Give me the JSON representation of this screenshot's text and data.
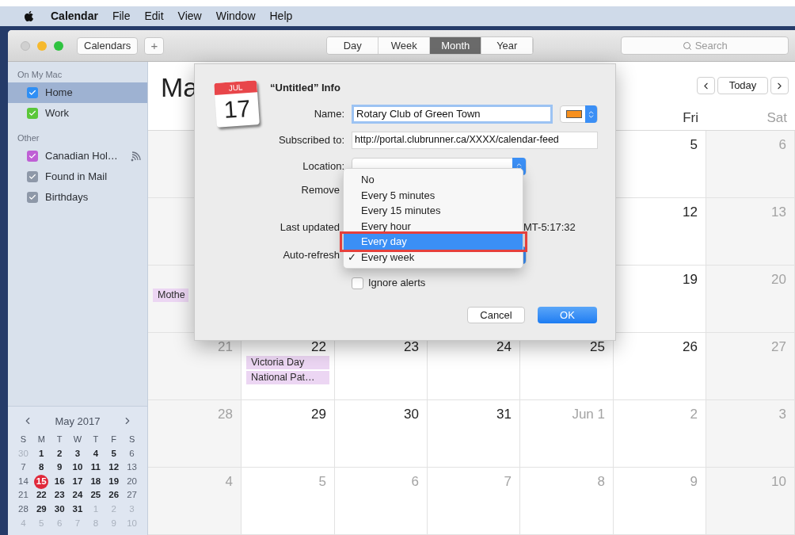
{
  "menubar": {
    "app": "Calendar",
    "items": [
      "File",
      "Edit",
      "View",
      "Window",
      "Help"
    ]
  },
  "toolbar": {
    "calendars_button": "Calendars",
    "add_button": "+",
    "views": [
      {
        "label": "Day",
        "selected": false
      },
      {
        "label": "Week",
        "selected": false
      },
      {
        "label": "Month",
        "selected": true
      },
      {
        "label": "Year",
        "selected": false
      }
    ],
    "search": {
      "placeholder": "Search"
    }
  },
  "sidebar": {
    "groups": [
      {
        "title": "On My Mac",
        "items": [
          {
            "name": "Home",
            "checked": true,
            "selected": true,
            "color": "#2f8ff5",
            "subscribed": false
          },
          {
            "name": "Work",
            "checked": true,
            "selected": false,
            "color": "#5bc73a",
            "subscribed": false
          }
        ]
      },
      {
        "title": "Other",
        "items": [
          {
            "name": "Canadian Hol…",
            "checked": true,
            "selected": false,
            "color": "#bf5fd5",
            "subscribed": true
          },
          {
            "name": "Found in Mail",
            "checked": true,
            "selected": false,
            "color": "#8e98a8",
            "subscribed": false
          },
          {
            "name": "Birthdays",
            "checked": true,
            "selected": false,
            "color": "#8e98a8",
            "subscribed": false
          }
        ]
      }
    ]
  },
  "mini_calendar": {
    "title": "May 2017",
    "weekdays": [
      "S",
      "M",
      "T",
      "W",
      "T",
      "F",
      "S"
    ],
    "weeks": [
      [
        {
          "day": "30",
          "kind": "other",
          "selected": false
        },
        {
          "day": "1",
          "kind": "weekday",
          "selected": false
        },
        {
          "day": "2",
          "kind": "weekday",
          "selected": false
        },
        {
          "day": "3",
          "kind": "weekday",
          "selected": false
        },
        {
          "day": "4",
          "kind": "weekday",
          "selected": false
        },
        {
          "day": "5",
          "kind": "weekday",
          "selected": false
        },
        {
          "day": "6",
          "kind": "weekend",
          "selected": false
        }
      ],
      [
        {
          "day": "7",
          "kind": "weekend",
          "selected": false
        },
        {
          "day": "8",
          "kind": "weekday",
          "selected": false
        },
        {
          "day": "9",
          "kind": "weekday",
          "selected": false
        },
        {
          "day": "10",
          "kind": "weekday",
          "selected": false
        },
        {
          "day": "11",
          "kind": "weekday",
          "selected": false
        },
        {
          "day": "12",
          "kind": "weekday",
          "selected": false
        },
        {
          "day": "13",
          "kind": "weekend",
          "selected": false
        }
      ],
      [
        {
          "day": "14",
          "kind": "weekend",
          "selected": false
        },
        {
          "day": "15",
          "kind": "weekday",
          "selected": true
        },
        {
          "day": "16",
          "kind": "weekday",
          "selected": false
        },
        {
          "day": "17",
          "kind": "weekday",
          "selected": false
        },
        {
          "day": "18",
          "kind": "weekday",
          "selected": false
        },
        {
          "day": "19",
          "kind": "weekday",
          "selected": false
        },
        {
          "day": "20",
          "kind": "weekend",
          "selected": false
        }
      ],
      [
        {
          "day": "21",
          "kind": "weekend",
          "selected": false
        },
        {
          "day": "22",
          "kind": "weekday",
          "selected": false
        },
        {
          "day": "23",
          "kind": "weekday",
          "selected": false
        },
        {
          "day": "24",
          "kind": "weekday",
          "selected": false
        },
        {
          "day": "25",
          "kind": "weekday",
          "selected": false
        },
        {
          "day": "26",
          "kind": "weekday",
          "selected": false
        },
        {
          "day": "27",
          "kind": "weekend",
          "selected": false
        }
      ],
      [
        {
          "day": "28",
          "kind": "weekend",
          "selected": false
        },
        {
          "day": "29",
          "kind": "weekday",
          "selected": false
        },
        {
          "day": "30",
          "kind": "weekday",
          "selected": false
        },
        {
          "day": "31",
          "kind": "weekday",
          "selected": false
        },
        {
          "day": "1",
          "kind": "other",
          "selected": false
        },
        {
          "day": "2",
          "kind": "other",
          "selected": false
        },
        {
          "day": "3",
          "kind": "other",
          "selected": false
        }
      ],
      [
        {
          "day": "4",
          "kind": "other",
          "selected": false
        },
        {
          "day": "5",
          "kind": "other",
          "selected": false
        },
        {
          "day": "6",
          "kind": "other",
          "selected": false
        },
        {
          "day": "7",
          "kind": "other",
          "selected": false
        },
        {
          "day": "8",
          "kind": "other",
          "selected": false
        },
        {
          "day": "9",
          "kind": "other",
          "selected": false
        },
        {
          "day": "10",
          "kind": "other",
          "selected": false
        }
      ]
    ]
  },
  "month_view": {
    "title": "Ma",
    "today_button": "Today",
    "weekday_headers": [
      {
        "label": "Fri",
        "dimmed": false
      },
      {
        "label": "Sat",
        "dimmed": true
      }
    ],
    "weeks": [
      {
        "cells": [
          {},
          {},
          {},
          {},
          {},
          {
            "day": "5",
            "dimmed": false
          },
          {
            "day": "6",
            "dimmed": true
          }
        ]
      },
      {
        "cells": [
          {},
          {},
          {},
          {},
          {},
          {
            "day": "12",
            "dimmed": false
          },
          {
            "day": "13",
            "dimmed": true
          }
        ]
      },
      {
        "cells": [
          {
            "events": [
              "Mothe"
            ]
          },
          {},
          {},
          {},
          {},
          {
            "day": "19",
            "dimmed": false
          },
          {
            "day": "20",
            "dimmed": true
          }
        ]
      },
      {
        "cells": [
          {
            "day": "21",
            "dimmed": true
          },
          {
            "day": "22",
            "dimmed": false,
            "events": [
              "Victoria Day",
              "National Pat…"
            ]
          },
          {
            "day": "23",
            "dimmed": false
          },
          {
            "day": "24",
            "dimmed": false
          },
          {
            "day": "25",
            "dimmed": false
          },
          {
            "day": "26",
            "dimmed": false
          },
          {
            "day": "27",
            "dimmed": true
          }
        ]
      },
      {
        "cells": [
          {
            "day": "28",
            "dimmed": true
          },
          {
            "day": "29",
            "dimmed": false
          },
          {
            "day": "30",
            "dimmed": false
          },
          {
            "day": "31",
            "dimmed": false
          },
          {
            "day": "Jun 1",
            "dimmed": true
          },
          {
            "day": "2",
            "dimmed": true
          },
          {
            "day": "3",
            "dimmed": true
          }
        ]
      },
      {
        "cells": [
          {
            "day": "4",
            "dimmed": true
          },
          {
            "day": "5",
            "dimmed": true
          },
          {
            "day": "6",
            "dimmed": true
          },
          {
            "day": "7",
            "dimmed": true
          },
          {
            "day": "8",
            "dimmed": true
          },
          {
            "day": "9",
            "dimmed": true
          },
          {
            "day": "10",
            "dimmed": true
          }
        ]
      }
    ]
  },
  "dialog": {
    "title": "“Untitled” Info",
    "icon_month": "JUL",
    "icon_day": "17",
    "name": {
      "label": "Name:",
      "value": "Rotary Club of Green Town",
      "color": "#f7901e"
    },
    "subscribed": {
      "label": "Subscribed to:",
      "value": "http://portal.clubrunner.ca/XXXX/calendar-feed"
    },
    "location": {
      "label": "Location:"
    },
    "remove": {
      "label": "Remove"
    },
    "last_updated": {
      "label": "Last updated",
      "value": "MT-5:17:32"
    },
    "auto_refresh": {
      "label": "Auto-refresh"
    },
    "ignore_alerts": {
      "label": "Ignore alerts",
      "checked": false
    },
    "cancel_button": "Cancel",
    "ok_button": "OK",
    "menu": {
      "check": "✓",
      "items": [
        {
          "label": "No",
          "checked": false,
          "selected": false,
          "annotated": false
        },
        {
          "label": "Every 5 minutes",
          "checked": false,
          "selected": false,
          "annotated": false
        },
        {
          "label": "Every 15 minutes",
          "checked": false,
          "selected": false,
          "annotated": false
        },
        {
          "label": "Every hour",
          "checked": false,
          "selected": false,
          "annotated": false
        },
        {
          "label": "Every day",
          "checked": false,
          "selected": true,
          "annotated": true
        },
        {
          "label": "Every week",
          "checked": true,
          "selected": false,
          "annotated": false
        }
      ]
    }
  }
}
